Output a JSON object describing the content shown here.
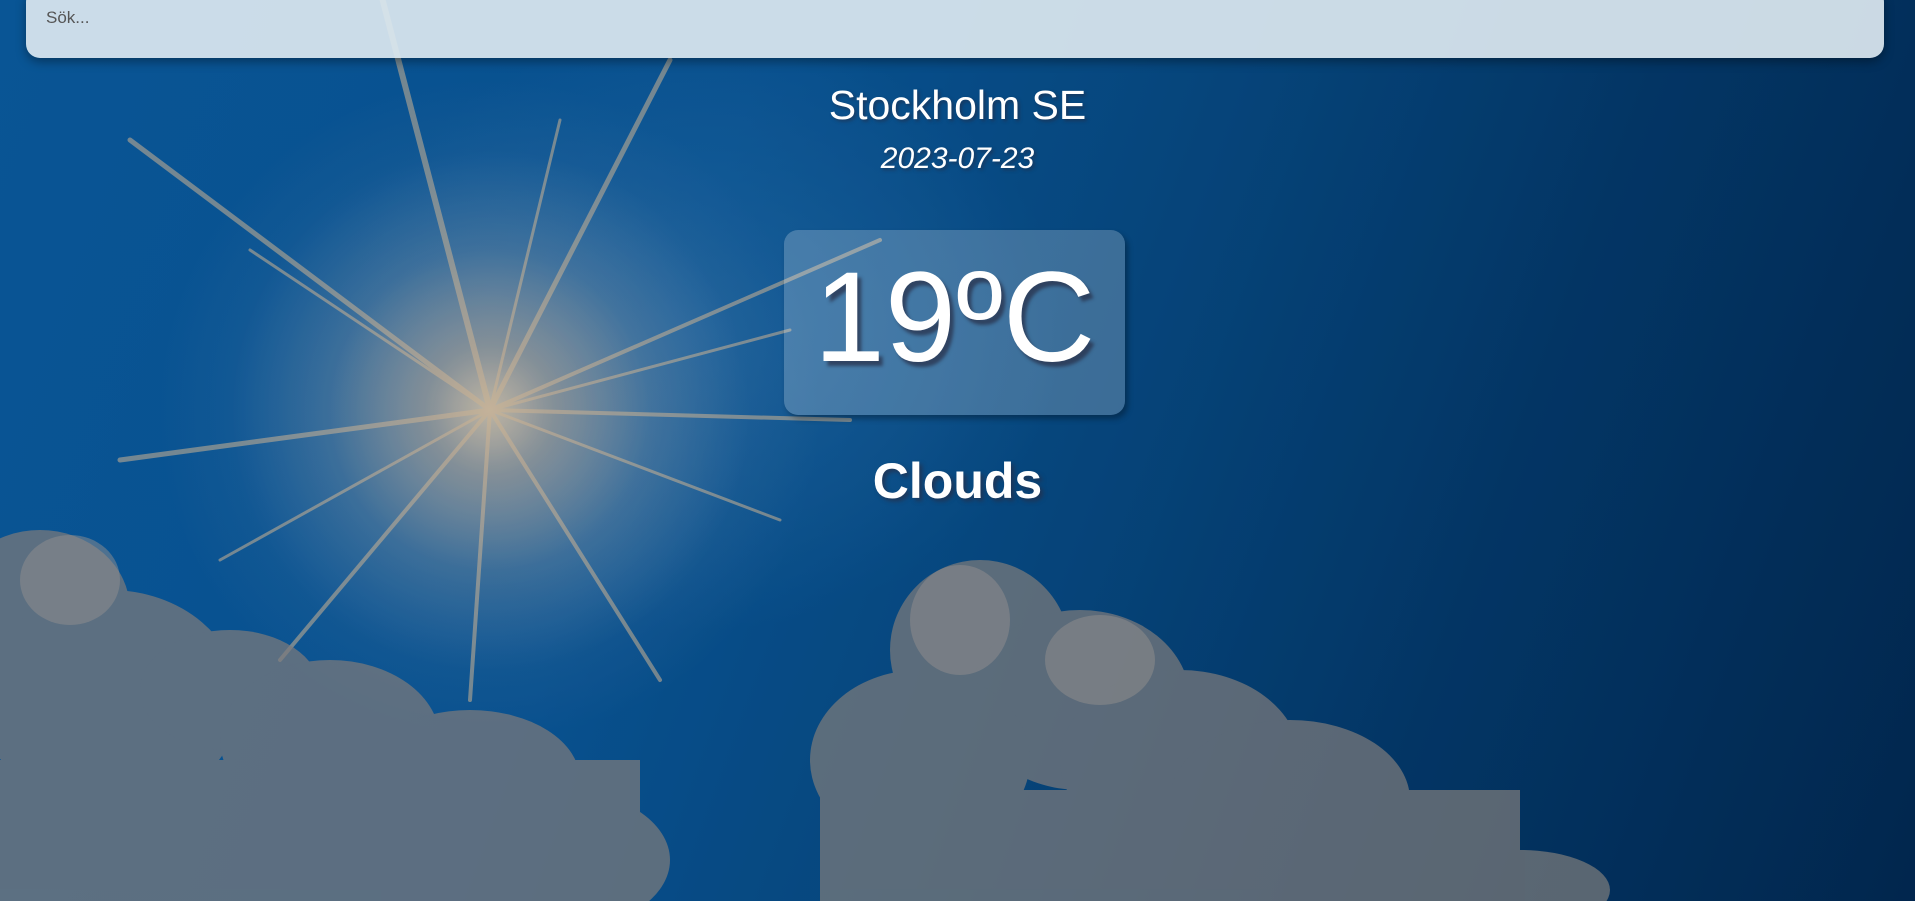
{
  "search": {
    "placeholder": "Sök..."
  },
  "weather": {
    "city": "Stockholm SE",
    "date": "2023-07-23",
    "temperature": "19ºC",
    "condition": "Clouds"
  },
  "background": {
    "image": "sunny-sky-with-clouds"
  },
  "colors": {
    "sky_light": "#0b5fa3",
    "sky_dark": "#022a52",
    "text": "#ffffff",
    "search_bg": "#dce8f0"
  }
}
